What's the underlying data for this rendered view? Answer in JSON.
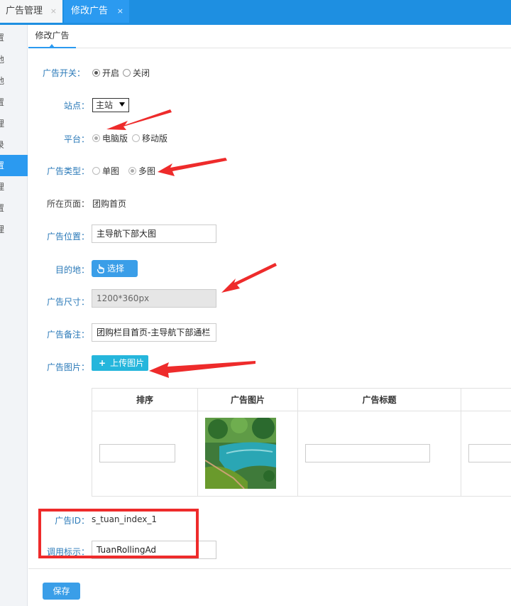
{
  "tabs": [
    {
      "label": "广告管理",
      "close": "×"
    },
    {
      "label": "修改广告",
      "close": "×"
    }
  ],
  "sidebar": {
    "items": [
      "置",
      "地",
      "地",
      "置",
      "理",
      "录",
      "置",
      "理",
      "置",
      "理"
    ],
    "active_index": 5
  },
  "subtab": {
    "label": "修改广告"
  },
  "form": {
    "switch": {
      "label": "广告开关：",
      "options": [
        "开启",
        "关闭"
      ],
      "selected": "开启"
    },
    "site": {
      "label": "站点：",
      "value": "主站"
    },
    "platform": {
      "label": "平台：",
      "options": [
        "电脑版",
        "移动版"
      ],
      "selected": "电脑版"
    },
    "type": {
      "label": "广告类型：",
      "options": [
        "单图",
        "多图"
      ],
      "selected": "多图"
    },
    "page": {
      "label": "所在页面：",
      "value": "团购首页"
    },
    "position": {
      "label": "广告位置：",
      "value": "主导航下部大图"
    },
    "destination": {
      "label": "目的地：",
      "button": "选择"
    },
    "size": {
      "label": "广告尺寸：",
      "value": "1200*360px"
    },
    "note": {
      "label": "广告备注：",
      "value": "团购栏目首页-主导航下部通栏"
    },
    "image": {
      "label": "广告图片：",
      "button": "上传图片",
      "plus": "+"
    },
    "ad_id": {
      "label": "广告ID：",
      "value": "s_tuan_index_1"
    },
    "call": {
      "label": "调用标示：",
      "value": "TuanRollingAd"
    }
  },
  "table": {
    "headers": [
      "排序",
      "广告图片",
      "广告标题"
    ]
  },
  "save_button": "保存",
  "colors": {
    "accent": "#1e8fe1",
    "label": "#2a79b8",
    "button": "#3a9ee8",
    "annotation_red": "#ee2b2b"
  }
}
